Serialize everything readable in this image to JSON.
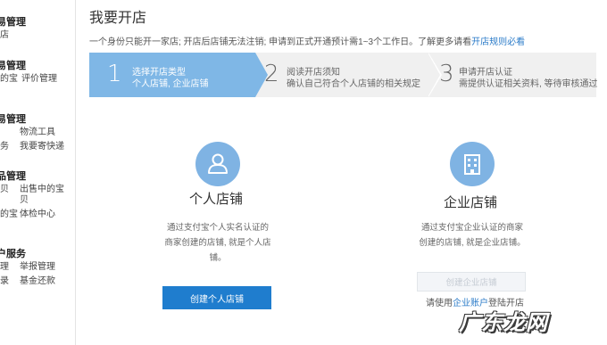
{
  "sidebar": {
    "groups": [
      {
        "heading": "易管理",
        "links": [
          "店"
        ]
      },
      {
        "heading": "易管理",
        "links": [
          "的宝",
          "评价管理"
        ]
      },
      {
        "heading": "易管理",
        "links": [
          "",
          "物流工具",
          "务",
          "我要寄快递"
        ]
      },
      {
        "heading": "品管理",
        "links": [
          "贝",
          "出售中的宝贝",
          "的宝",
          "体检中心"
        ]
      },
      {
        "heading": "户服务",
        "links": [
          "理",
          "举报管理",
          "录",
          "基金还款"
        ]
      }
    ]
  },
  "page": {
    "title": "我要开店",
    "notice_text": "一个身份只能开一家店; 开店后店铺无法注销; 申请到正式开通预计需1~3个工作日。了解更多请看",
    "notice_link": "开店规则必看"
  },
  "steps": [
    {
      "number": "1",
      "title": "选择开店类型",
      "subtitle": "个人店铺, 企业店铺"
    },
    {
      "number": "2",
      "title": "阅读开店须知",
      "subtitle": "确认自己符合个人店铺的相关规定"
    },
    {
      "number": "3",
      "title": "申请开店认证",
      "subtitle": "需提供认证相关资料, 等待审核通过"
    }
  ],
  "personal": {
    "title": "个人店铺",
    "desc": [
      "通过支付宝个人实名认证的",
      "商家创建的店铺, 就是个人店",
      "铺。"
    ],
    "button": "创建个人店铺"
  },
  "enterprise": {
    "title": "企业店铺",
    "desc": [
      "通过支付宝企业认证的商家",
      "创建的店铺, 就是企业店铺。"
    ],
    "button": "创建企业店铺",
    "hint_prefix": "请使用",
    "hint_link": "企业账户",
    "hint_suffix": "登陆开店"
  },
  "watermark": "广东龙网",
  "colors": {
    "active_step": "#7fb7e6",
    "inactive_step": "#f0f0f0",
    "primary_button": "#1f7dce",
    "link": "#2c7cc9",
    "icon_circle": "#7fb3e3"
  }
}
